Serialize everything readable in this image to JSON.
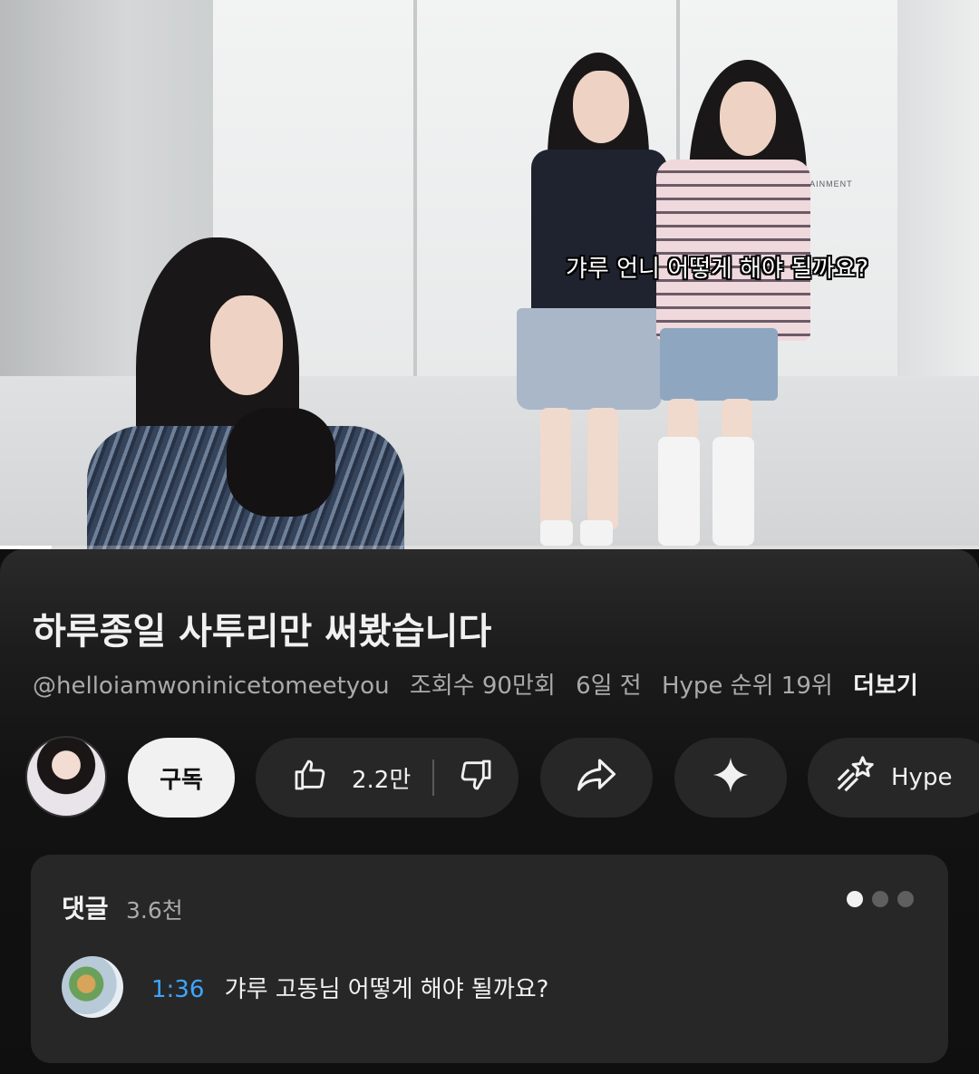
{
  "video": {
    "caption": "갸루 언니 어떻게 해야 될까요?",
    "progress_percent": 5.3,
    "background_logo_text": "RTAINMENT"
  },
  "details": {
    "title": "하루종일 사투리만 써봤습니다",
    "channel_handle": "@helloiamwoninicetomeetyou",
    "views": "조회수 90만회",
    "age": "6일 전",
    "hype_rank": "Hype 순위 19위",
    "more_label": "더보기"
  },
  "actions": {
    "subscribe_label": "구독",
    "like_count": "2.2만",
    "hype_label": "Hype",
    "icons": {
      "avatar": "channel-avatar",
      "like": "thumbs-up-icon",
      "dislike": "thumbs-down-icon",
      "share": "share-icon",
      "ai": "sparkle-icon",
      "hype": "hype-rocket-icon"
    }
  },
  "comments": {
    "heading": "댓글",
    "count": "3.6천",
    "pages": 3,
    "active_page": 1,
    "top_comment": {
      "timestamp": "1:36",
      "text": "갸루 고동님 어떻게 해야 될까요?"
    }
  },
  "colors": {
    "background": "#0f0f0f",
    "surface": "#272727",
    "link_blue": "#3ea6ff",
    "subscribe_bg": "#f1f1f1"
  }
}
